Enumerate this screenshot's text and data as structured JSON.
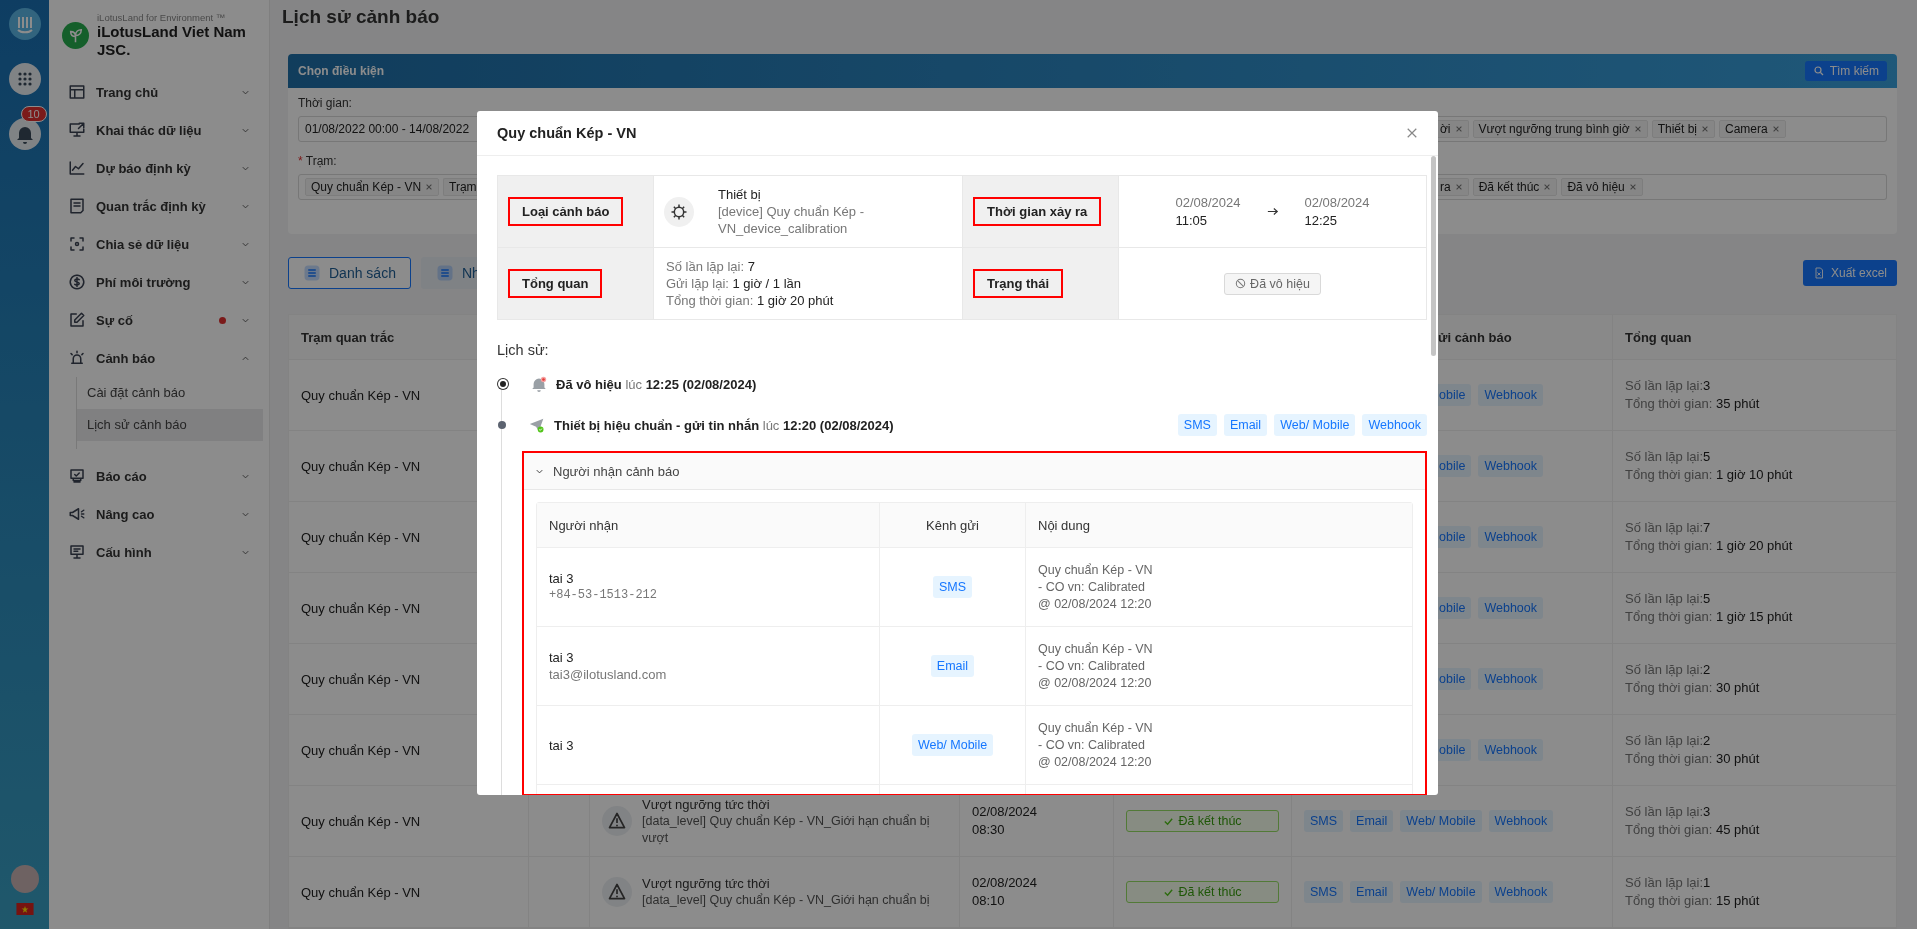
{
  "rail": {
    "notification_count": "10"
  },
  "brand": {
    "tagline": "iLotusLand for Environment ™",
    "name": "iLotusLand Viet Nam JSC."
  },
  "menu": [
    {
      "label": "Trang chủ",
      "expanded": false,
      "alert": false
    },
    {
      "label": "Khai thác dữ liệu",
      "expanded": false,
      "alert": false
    },
    {
      "label": "Dự báo định kỳ",
      "expanded": false,
      "alert": false
    },
    {
      "label": "Quan trắc định kỳ",
      "expanded": false,
      "alert": false
    },
    {
      "label": "Chia sẻ dữ liệu",
      "expanded": false,
      "alert": false
    },
    {
      "label": "Phí môi trường",
      "expanded": false,
      "alert": false
    },
    {
      "label": "Sự cố",
      "expanded": false,
      "alert": true
    },
    {
      "label": "Cảnh báo",
      "expanded": true,
      "alert": false,
      "children": [
        {
          "label": "Cài đặt cảnh báo",
          "selected": false
        },
        {
          "label": "Lịch sử cảnh báo",
          "selected": true
        }
      ]
    },
    {
      "label": "Báo cáo",
      "expanded": false,
      "alert": false
    },
    {
      "label": "Nâng cao",
      "expanded": false,
      "alert": false
    },
    {
      "label": "Cấu hình",
      "expanded": false,
      "alert": false
    }
  ],
  "page_title": "Lịch sử cảnh báo",
  "filter": {
    "title": "Chọn điều kiện",
    "search_button": "Tìm kiếm",
    "time_label": "Thời gian:",
    "time_value": "01/08/2022 00:00 - 14/08/2022",
    "type_tags": [
      {
        "label": "ời",
        "kind": "tail"
      },
      {
        "label": "Vượt ngưỡng trung bình giờ",
        "kind": "full"
      },
      {
        "label": "Thiết bị",
        "kind": "full"
      },
      {
        "label": "Camera",
        "kind": "full"
      }
    ],
    "required_mark": "*",
    "station_label": "Trạm:",
    "station_tags": [
      {
        "label": "Quy chuẩn Kép - VN",
        "kind": "full"
      },
      {
        "label": "Trạm",
        "kind": "head"
      }
    ],
    "status_tags": [
      {
        "label": "ra",
        "kind": "tail"
      },
      {
        "label": "Đã kết thúc",
        "kind": "full"
      },
      {
        "label": "Đã vô hiệu",
        "kind": "full"
      }
    ]
  },
  "views": [
    {
      "label": "Danh sách",
      "selected": true
    },
    {
      "label": "Nh",
      "selected": false
    }
  ],
  "export_button": "Xuất excel",
  "table": {
    "columns": [
      {
        "label": "Trạm quan trắc",
        "kind": "full"
      },
      {
        "label": "ửi cảnh báo",
        "kind": "tail"
      },
      {
        "label": "Tổng quan",
        "kind": "full"
      }
    ],
    "rows": [
      {
        "station": "Quy chuẩn Kép - VN",
        "channels": [
          {
            "label": "obile",
            "kind": "tail"
          },
          {
            "label": "Webhook",
            "kind": "full"
          }
        ],
        "summary": {
          "repeat_label": "Số lần lặp lại:",
          "repeat": "3",
          "total_label": "Tổng thời gian:",
          "total": "35 phút"
        }
      },
      {
        "station": "Quy chuẩn Kép - VN",
        "channels": [
          {
            "label": "obile",
            "kind": "tail"
          },
          {
            "label": "Webhook",
            "kind": "full"
          }
        ],
        "summary": {
          "repeat_label": "Số lần lặp lại:",
          "repeat": "5",
          "total_label": "Tổng thời gian:",
          "total": "1 giờ 10 phút"
        }
      },
      {
        "station": "Quy chuẩn Kép - VN",
        "channels": [
          {
            "label": "obile",
            "kind": "tail"
          },
          {
            "label": "Webhook",
            "kind": "full"
          }
        ],
        "summary": {
          "repeat_label": "Số lần lặp lại:",
          "repeat": "7",
          "total_label": "Tổng thời gian:",
          "total": "1 giờ 20 phút"
        }
      },
      {
        "station": "Quy chuẩn Kép - VN",
        "channels": [
          {
            "label": "obile",
            "kind": "tail"
          },
          {
            "label": "Webhook",
            "kind": "full"
          }
        ],
        "summary": {
          "repeat_label": "Số lần lặp lại:",
          "repeat": "5",
          "total_label": "Tổng thời gian:",
          "total": "1 giờ 15 phút"
        }
      },
      {
        "station": "Quy chuẩn Kép - VN",
        "channels": [
          {
            "label": "obile",
            "kind": "tail"
          },
          {
            "label": "Webhook",
            "kind": "full"
          }
        ],
        "summary": {
          "repeat_label": "Số lần lặp lại:",
          "repeat": "2",
          "total_label": "Tổng thời gian:",
          "total": "30 phút"
        }
      },
      {
        "station": "Quy chuẩn Kép - VN",
        "channels": [
          {
            "label": "obile",
            "kind": "tail"
          },
          {
            "label": "Webhook",
            "kind": "full"
          }
        ],
        "summary": {
          "repeat_label": "Số lần lặp lại:",
          "repeat": "2",
          "total_label": "Tổng thời gian:",
          "total": "30 phút"
        }
      },
      {
        "station": "Quy chuẩn Kép - VN",
        "alert": {
          "title": "Vượt ngưỡng tức thời",
          "detail": "[data_level] Quy chuẩn Kép - VN_Giới hạn chuẩn bị vượt"
        },
        "time": {
          "date": "02/08/2024",
          "clock": "08:30"
        },
        "status": {
          "label": "Đã kết thúc",
          "kind": "ended"
        },
        "channels": [
          {
            "label": "SMS",
            "kind": "full"
          },
          {
            "label": "Email",
            "kind": "full"
          },
          {
            "label": "Web/ Mobile",
            "kind": "full"
          },
          {
            "label": "Webhook",
            "kind": "full"
          }
        ],
        "summary": {
          "repeat_label": "Số lần lặp lại:",
          "repeat": "3",
          "total_label": "Tổng thời gian:",
          "total": "45 phút"
        }
      },
      {
        "station": "Quy chuẩn Kép - VN",
        "alert": {
          "title": "Vượt ngưỡng tức thời",
          "detail": "[data_level] Quy chuẩn Kép - VN_Giới hạn chuẩn bị"
        },
        "time": {
          "date": "02/08/2024",
          "clock": "08:10"
        },
        "status": {
          "label": "Đã kết thúc",
          "kind": "ended"
        },
        "channels": [
          {
            "label": "SMS",
            "kind": "full"
          },
          {
            "label": "Email",
            "kind": "full"
          },
          {
            "label": "Web/ Mobile",
            "kind": "full"
          },
          {
            "label": "Webhook",
            "kind": "full"
          }
        ],
        "summary": {
          "repeat_label": "Số lần lặp lại:",
          "repeat": "1",
          "total_label": "Tổng thời gian:",
          "total": "15 phút"
        }
      }
    ]
  },
  "modal": {
    "title": "Quy chuẩn Kép - VN",
    "info": {
      "type_label": {
        "text": "Loại cảnh báo",
        "highlighted": true
      },
      "type_name": "Thiết bị",
      "type_detail": "[device] Quy chuẩn Kép - VN_device_calibration",
      "time_label": {
        "text": "Thời gian xảy ra",
        "highlighted": true
      },
      "start_date": "02/08/2024",
      "start_time": "11:05",
      "end_date": "02/08/2024",
      "end_time": "12:25",
      "overview_label": {
        "text": "Tổng quan",
        "highlighted": true
      },
      "overview": [
        {
          "label": "Số lần lặp lại:",
          "value": "7"
        },
        {
          "label": "Gửi lặp lại:",
          "value": "1 giờ / 1 lần"
        },
        {
          "label": "Tổng thời gian:",
          "value": "1 giờ 20 phút"
        }
      ],
      "status_label": {
        "text": "Trạng thái",
        "highlighted": true
      },
      "status": {
        "label": "Đã vô hiệu",
        "kind": "disabled"
      }
    },
    "history_title": "Lịch sử:",
    "history": [
      {
        "kind": "disabled",
        "selected": true,
        "event": "Đã vô hiệu",
        "at": "lúc",
        "time": "12:25 (02/08/2024)"
      },
      {
        "kind": "sent",
        "selected": false,
        "event": "Thiết bị hiệu chuẩn - gửi tin nhắn",
        "at": "lúc",
        "time": "12:20 (02/08/2024)",
        "channels": [
          "SMS",
          "Email",
          "Web/ Mobile",
          "Webhook"
        ],
        "recipients": {
          "title": "Người nhận cảnh báo",
          "expanded": true,
          "highlighted": true,
          "columns": [
            "Người nhận",
            "Kênh gửi",
            "Nội dung"
          ],
          "rows": [
            {
              "name": "tai 3",
              "contact": "+84-53-1513-212",
              "kind": "phone",
              "channel": "SMS",
              "content": [
                "Quy chuẩn Kép - VN",
                "- CO vn: Calibrated",
                "@ 02/08/2024 12:20"
              ]
            },
            {
              "name": "tai 3",
              "contact": "tai3@ilotusland.com",
              "kind": "email",
              "channel": "Email",
              "content": [
                "Quy chuẩn Kép - VN",
                "- CO vn: Calibrated",
                "@ 02/08/2024 12:20"
              ]
            },
            {
              "name": "tai 3",
              "channel": "Web/ Mobile",
              "content": [
                "Quy chuẩn Kép - VN",
                "- CO vn: Calibrated",
                "@ 02/08/2024 12:20"
              ]
            }
          ]
        }
      }
    ]
  }
}
